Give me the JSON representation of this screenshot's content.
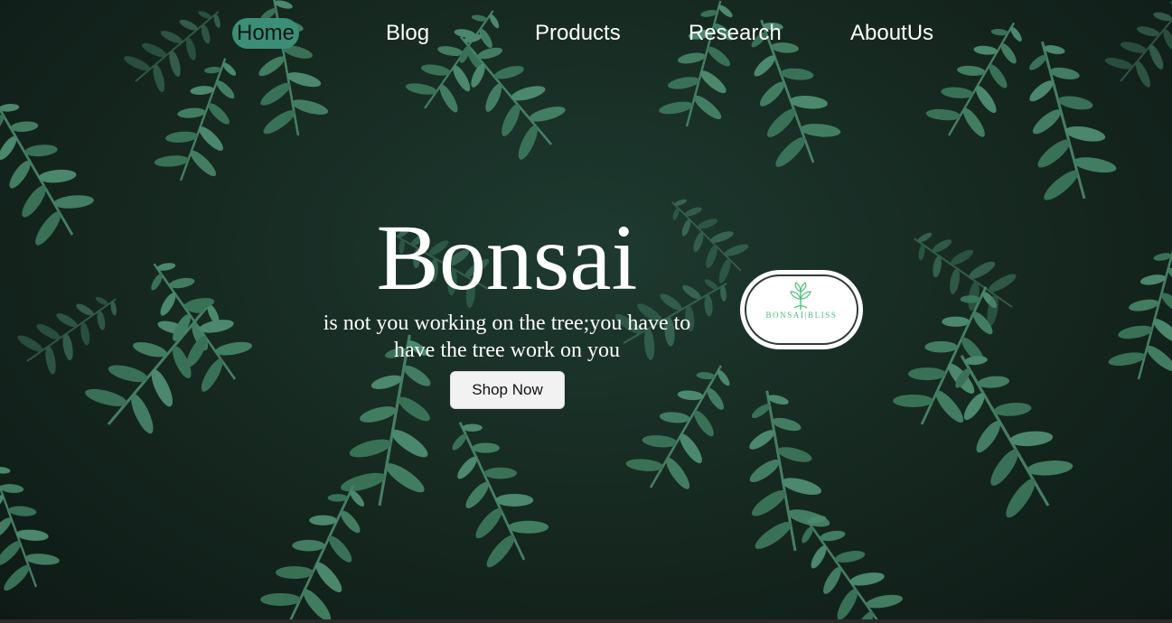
{
  "nav": {
    "items": [
      {
        "label": "Home",
        "active": true
      },
      {
        "label": "Blog",
        "active": false
      },
      {
        "label": "Products",
        "active": false
      },
      {
        "label": "Research",
        "active": false
      },
      {
        "label": "AboutUs",
        "active": false
      }
    ]
  },
  "hero": {
    "title": "Bonsai",
    "subtitle": "is not you working on the tree;you have to have the tree work on you",
    "cta_label": "Shop Now",
    "background": "fern-leaves-photo"
  },
  "logo": {
    "text": "BONSAI|BLISS",
    "icon": "sprout-icon"
  },
  "colors": {
    "accent": "#3b8f77",
    "logo_green": "#4fbf7a",
    "text": "#ffffff",
    "button_bg": "#f2f2f2"
  }
}
